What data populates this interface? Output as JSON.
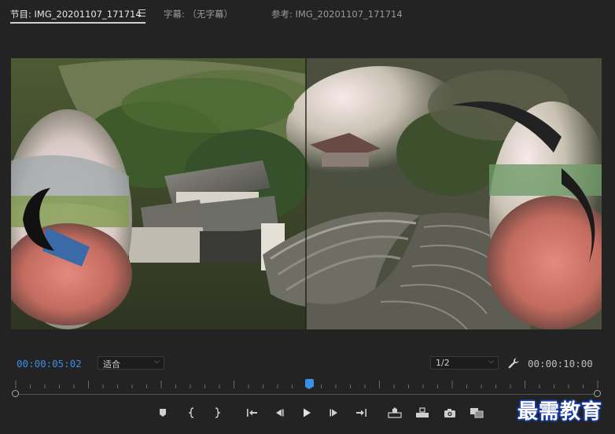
{
  "tabs": {
    "program": "节目: IMG_20201107_171714",
    "captions": "字幕: （无字幕）",
    "reference": "参考: IMG_20201107_171714"
  },
  "controls": {
    "current_timecode": "00:00:05:02",
    "zoom_value": "适合",
    "resolution_value": "1/2",
    "duration_timecode": "00:00:10:00"
  },
  "playback": {
    "position_fraction": 0.505
  },
  "colors": {
    "accent": "#3a8ee6",
    "panel_bg": "#232323",
    "watermark_outline": "#1a3ea8"
  },
  "transport_icons": [
    "add-marker-icon",
    "mark-in-icon",
    "mark-out-icon",
    "go-to-in-icon",
    "step-back-icon",
    "play-icon",
    "step-forward-icon",
    "go-to-out-icon",
    "lift-icon",
    "extract-icon",
    "export-frame-icon",
    "comparison-view-icon"
  ],
  "watermark": {
    "text": "最需教育"
  }
}
